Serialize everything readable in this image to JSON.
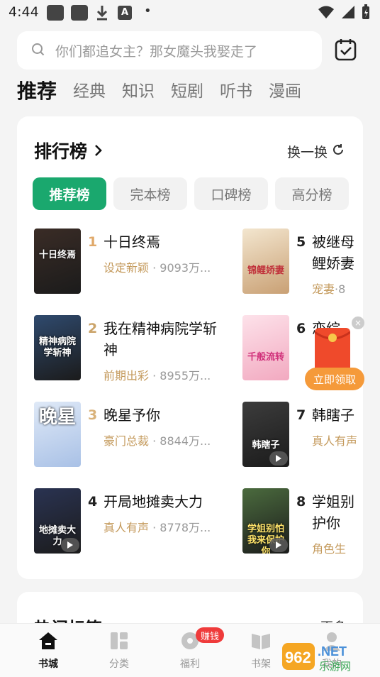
{
  "status_bar": {
    "time": "4:44",
    "a_icon": "A",
    "dot": "•"
  },
  "search": {
    "placeholder": "你们都追女主？那女魔头我娶走了",
    "icon": "search-icon"
  },
  "checkin_icon": "calendar-check-icon",
  "top_tabs": [
    "推荐",
    "经典",
    "知识",
    "短剧",
    "听书",
    "漫画"
  ],
  "active_tab": 0,
  "ranking": {
    "title": "排行榜",
    "swap_label": "换一换",
    "chips": [
      "推荐榜",
      "完本榜",
      "口碑榜",
      "高分榜"
    ],
    "active_chip": 0,
    "books": [
      {
        "rank": "1",
        "title": "十日终焉",
        "tag": "设定新颖",
        "heat": "9093万...",
        "cover_text": "十日终焉",
        "cover_color": "#3a2c26",
        "rank_color": "#e0a96a",
        "audio": false
      },
      {
        "rank": "2",
        "title": "我在精神病院学斩神",
        "tag": "前期出彩",
        "heat": "8955万...",
        "cover_text": "精神病院学斩神",
        "cover_color": "#2f4a6e",
        "rank_color": "#cba46a",
        "audio": false
      },
      {
        "rank": "3",
        "title": "晚星予你",
        "tag": "豪门总裁",
        "heat": "8844万...",
        "cover_text": "晚星",
        "cover_color": "#b8cce8",
        "rank_color": "#d9b27a",
        "audio": false
      },
      {
        "rank": "4",
        "title": "开局地摊卖大力",
        "tag": "真人有声",
        "heat": "8778万...",
        "cover_text": "地摊卖大力",
        "cover_color": "#2a3352",
        "rank_color": "#222222",
        "audio": true
      },
      {
        "rank": "5",
        "title": "被继母",
        "title2": "鲤娇妻",
        "tag": "宠妻",
        "heat": "·8",
        "cover_text": "锦鲤娇妻",
        "cover_color": "#cfae7e",
        "rank_color": "#222222",
        "audio": false
      },
      {
        "rank": "6",
        "title": "恋综",
        "tag": "",
        "heat": "",
        "cover_text": "千般流转",
        "cover_color": "#f2b6c6",
        "rank_color": "#222222",
        "audio": false
      },
      {
        "rank": "7",
        "title": "韩瞎子",
        "tag": "真人有声",
        "heat": "",
        "cover_text": "韩瞎子",
        "cover_color": "#3c3c3c",
        "rank_color": "#222222",
        "audio": true
      },
      {
        "rank": "8",
        "title": "学姐别",
        "title2": "护你",
        "tag": "角色生",
        "heat": "",
        "cover_text": "学姐别怕我来保护你",
        "cover_color": "#4b6b3e",
        "rank_color": "#222222",
        "audio": true
      }
    ]
  },
  "hot_tags": {
    "title": "热门标签",
    "more": "更多"
  },
  "red_packet": {
    "button": "立即领取",
    "close": "×"
  },
  "bottom_nav": [
    {
      "label": "书城",
      "icon": "home-icon"
    },
    {
      "label": "分类",
      "icon": "category-icon"
    },
    {
      "label": "福利",
      "icon": "gift-disc-icon"
    },
    {
      "label": "书架",
      "icon": "bookshelf-icon"
    },
    {
      "label": "我的",
      "icon": "profile-icon"
    }
  ],
  "welfare_badge": "赚钱",
  "watermark": {
    "main": "962.NET",
    "sub": "乐游网"
  },
  "colors": {
    "accent": "#1aa86e",
    "tag": "#c49a5c",
    "badge": "#ef3b3b",
    "red_packet": "#f59a3a"
  }
}
